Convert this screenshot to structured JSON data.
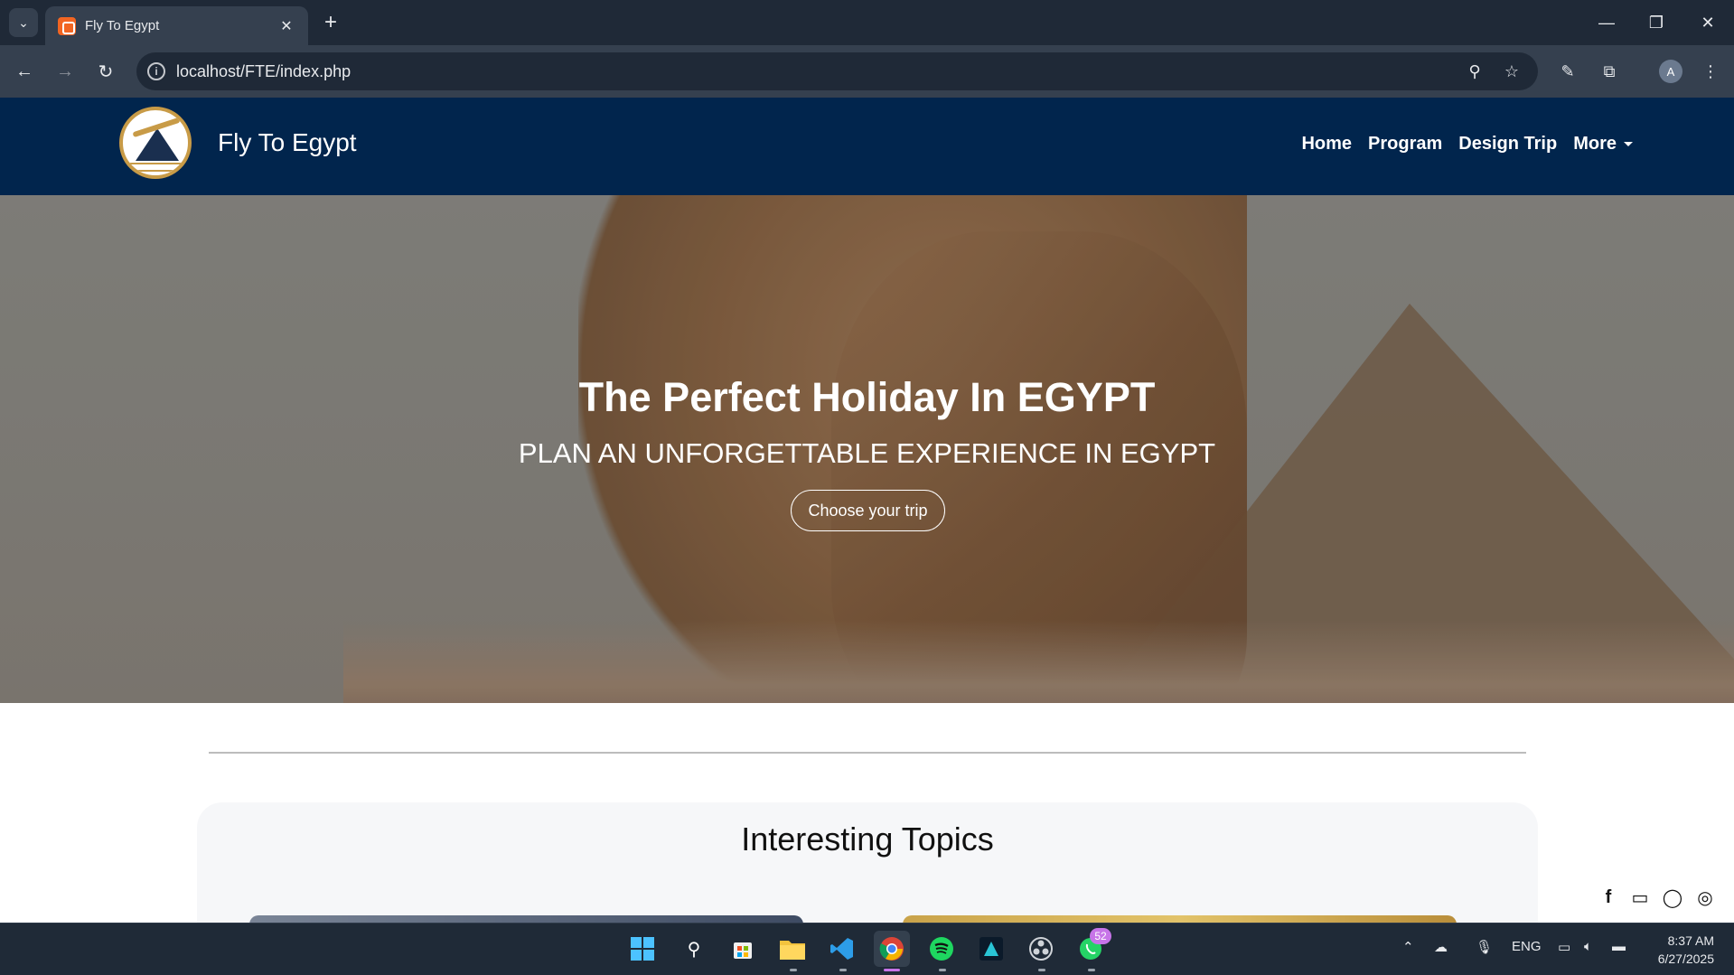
{
  "browser": {
    "tab_title": "Fly To Egypt",
    "url": "localhost/FTE/index.php",
    "avatar_letter": "A"
  },
  "site": {
    "brand": "Fly To Egypt",
    "nav": [
      "Home",
      "Program",
      "Design Trip",
      "More"
    ]
  },
  "hero": {
    "title": "The Perfect Holiday In EGYPT",
    "subtitle": "PLAN AN UNFORGETTABLE EXPERIENCE IN EGYPT",
    "button": "Choose your trip"
  },
  "topics": {
    "title": "Interesting Topics"
  },
  "social": [
    "facebook-icon",
    "inbox-icon",
    "whatsapp-icon",
    "instagram-icon"
  ],
  "taskbar": {
    "apps": [
      "start-icon",
      "search-icon",
      "store-icon",
      "file-explorer-icon",
      "vscode-icon",
      "chrome-icon",
      "spotify-icon",
      "app-icon",
      "obs-icon",
      "whatsapp-icon"
    ],
    "whatsapp_badge": "52",
    "language": "ENG",
    "time": "8:37 AM",
    "date": "6/27/2025"
  },
  "colors": {
    "header_bg": "#01254d",
    "chrome_dark": "#1f2937",
    "chrome_mid": "#35404f",
    "logo_gold": "#c89b47"
  }
}
